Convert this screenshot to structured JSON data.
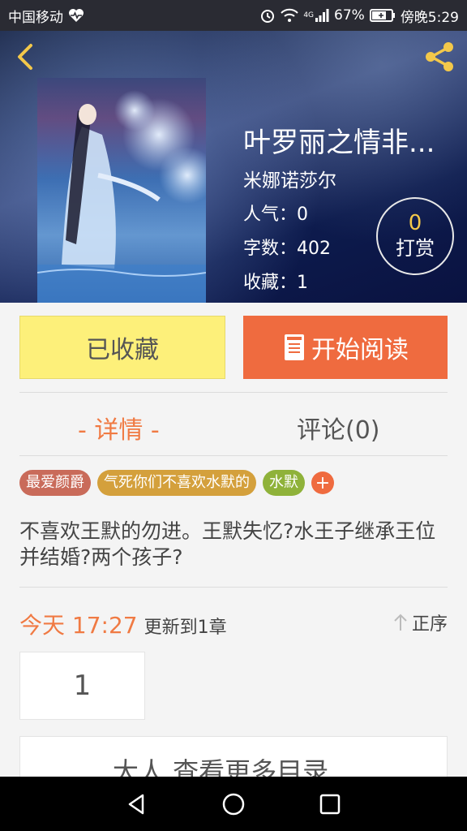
{
  "status_bar": {
    "carrier": "中国移动",
    "signal_type": "4G",
    "battery": "67%",
    "time": "傍晚5:29"
  },
  "header": {
    "title": "叶罗丽之情非...",
    "author": "米娜诺莎尔",
    "popularity": "人气：0",
    "word_count": "字数：402",
    "favorites": "收藏：1",
    "reward_count": "0",
    "reward_label": "打赏"
  },
  "actions": {
    "favorited_label": "已收藏",
    "read_label": "开始阅读"
  },
  "tabs": {
    "detail": "- 详情 -",
    "comment": "评论(0)"
  },
  "tags": [
    {
      "label": "最爱颜爵",
      "color": "#c96b5a"
    },
    {
      "label": "气死你们不喜欢水默的",
      "color": "#d4a03c"
    },
    {
      "label": "水默",
      "color": "#8fb23a"
    }
  ],
  "tag_add": "+",
  "description": "不喜欢王默的勿进。王默失忆?水王子继承王位并结婚?两个孩子?",
  "update": {
    "time": "今天 17:27",
    "info": "更新到1章",
    "sort_label": "正序"
  },
  "chapter_page": "1",
  "more_catalog": "大人    查看更多目录"
}
